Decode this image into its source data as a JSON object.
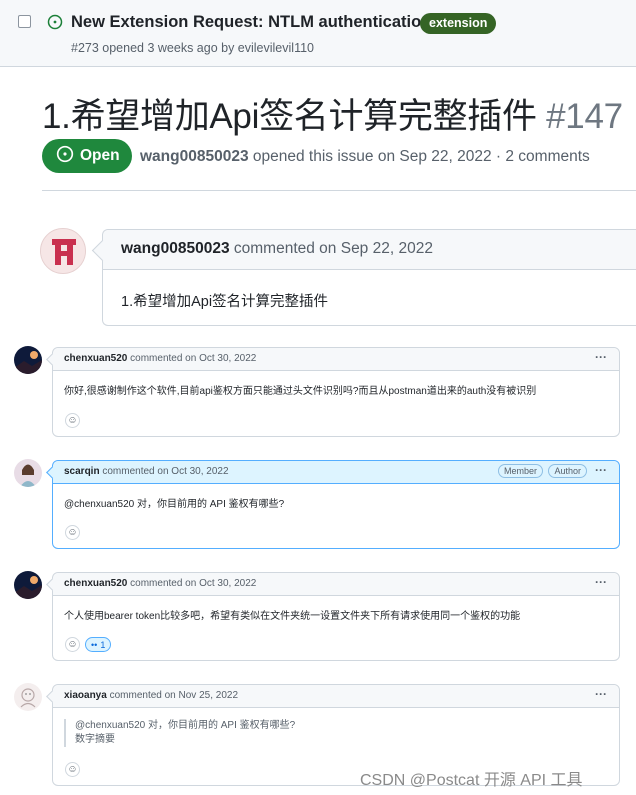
{
  "top_issue": {
    "title": "New Extension Request: NTLM authentication",
    "label": "extension",
    "meta": "#273 opened 3 weeks ago by evilevilevil110"
  },
  "issue": {
    "title": "1.希望增加Api签名计算完整插件",
    "number": "#147",
    "state": "Open",
    "author": "wang00850023",
    "meta_rest": "opened this issue on Sep 22, 2022 · 2 comments"
  },
  "first_comment": {
    "author": "wang00850023",
    "action": "commented on Sep 22, 2022",
    "body": "1.希望增加Api签名计算完整插件"
  },
  "comments": [
    {
      "author": "chenxuan520",
      "action": "commented on Oct 30, 2022",
      "body": "你好,很感谢制作这个软件,目前api鉴权方面只能通过头文件识别吗?而且从postman道出来的auth没有被识别",
      "menu": "···"
    },
    {
      "author": "scarqin",
      "action": "commented on Oct 30, 2022",
      "body": "@chenxuan520 对，你目前用的 API 鉴权有哪些?",
      "badge_member": "Member",
      "badge_author": "Author",
      "menu": "···"
    },
    {
      "author": "chenxuan520",
      "action": "commented on Oct 30, 2022",
      "body": "个人使用bearer token比较多吧，希望有类似在文件夹统一设置文件夹下所有请求使用同一个鉴权的功能",
      "reaction_count": "1",
      "menu": "···"
    },
    {
      "author": "xiaoanya",
      "action": "commented on Nov 25, 2022",
      "quote_line1": "@chenxuan520 对，你目前用的 API 鉴权有哪些?",
      "quote_line2": "数字摘要",
      "menu": "···"
    }
  ],
  "watermark": "CSDN @Postcat 开源 API 工具",
  "colors": {
    "open_green": "#1f883d",
    "label_green": "#356425",
    "author_blue": "#ddf4ff"
  }
}
